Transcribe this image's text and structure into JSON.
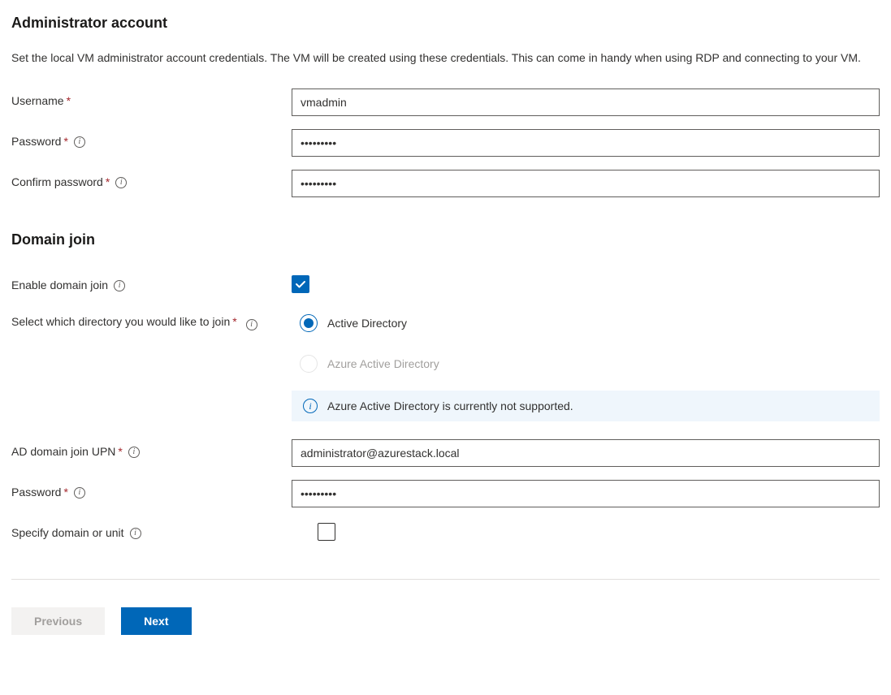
{
  "admin": {
    "heading": "Administrator account",
    "description": "Set the local VM administrator account credentials. The VM will be created using these credentials. This can come in handy when using RDP and connecting to your VM.",
    "username_label": "Username",
    "username_value": "vmadmin",
    "password_label": "Password",
    "password_value": "•••••••••",
    "confirm_label": "Confirm password",
    "confirm_value": "•••••••••"
  },
  "domain": {
    "heading": "Domain join",
    "enable_label": "Enable domain join",
    "enable_checked": true,
    "directory_label": "Select which directory you would like to join",
    "directory_options": {
      "ad": "Active Directory",
      "aad": "Azure Active Directory"
    },
    "directory_selected": "ad",
    "info_message": "Azure Active Directory is currently not supported.",
    "upn_label": "AD domain join UPN",
    "upn_value": "administrator@azurestack.local",
    "ad_password_label": "Password",
    "ad_password_value": "•••••••••",
    "specify_label": "Specify domain or unit",
    "specify_checked": false
  },
  "footer": {
    "previous": "Previous",
    "next": "Next"
  }
}
